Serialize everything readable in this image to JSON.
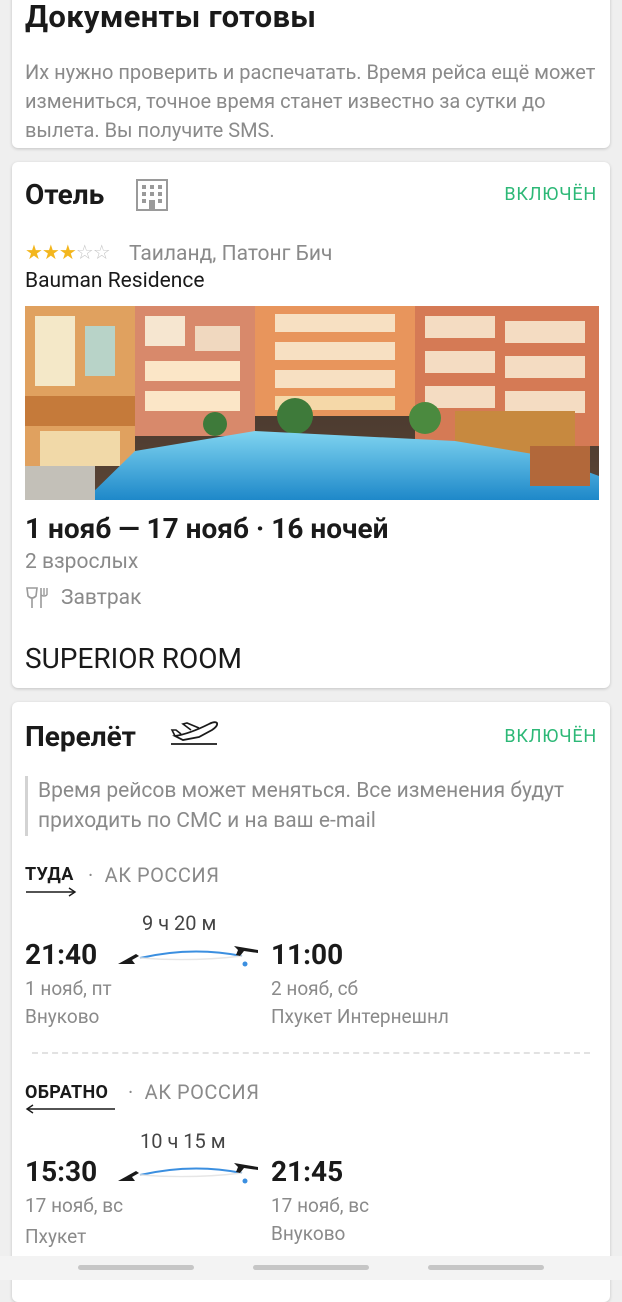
{
  "docs": {
    "title": "Документы готовы",
    "text": "Их нужно проверить и распечатать. Время рейса ещё может измениться, точное время станет известно за сутки до вылета. Вы получите SMS."
  },
  "hotel": {
    "title": "Отель",
    "status": "ВКЛЮЧЁН",
    "stars_filled": 3,
    "stars_total": 5,
    "stars_on": "★★★",
    "stars_off": "☆☆",
    "location": "Таиланд, Патонг Бич",
    "name": "Bauman Residence",
    "dates": "1 нояб — 17 нояб · 16 ночей",
    "guests": "2 взрослых",
    "meal": "Завтрак",
    "room": "SUPERIOR ROOM",
    "icons": {
      "title": "building-icon",
      "meal": "cutlery-icon"
    }
  },
  "flight": {
    "title": "Перелёт",
    "status": "ВКЛЮЧЁН",
    "notice": "Время рейсов может меняться. Все изменения будут приходить по СМС и на ваш e-mail",
    "outbound": {
      "label": "ТУДА",
      "airline": "АК РОССИЯ",
      "duration": "9 ч 20 м",
      "dep_time": "21:40",
      "dep_date": "1 нояб, пт",
      "dep_airport": "Внуково",
      "arr_time": "11:00",
      "arr_date": "2 нояб, сб",
      "arr_airport": "Пхукет Интернешнл"
    },
    "inbound": {
      "label": "ОБРАТНО",
      "airline": "АК РОССИЯ",
      "duration": "10 ч 15 м",
      "dep_time": "15:30",
      "dep_date": "17 нояб, вс",
      "dep_airport": "Пхукет Интернешнл",
      "arr_time": "21:45",
      "arr_date": "17 нояб, вс",
      "arr_airport": "Внуково"
    }
  },
  "colors": {
    "accent": "#2db877",
    "star": "#f3b61d",
    "route": "#3b8fe0"
  }
}
